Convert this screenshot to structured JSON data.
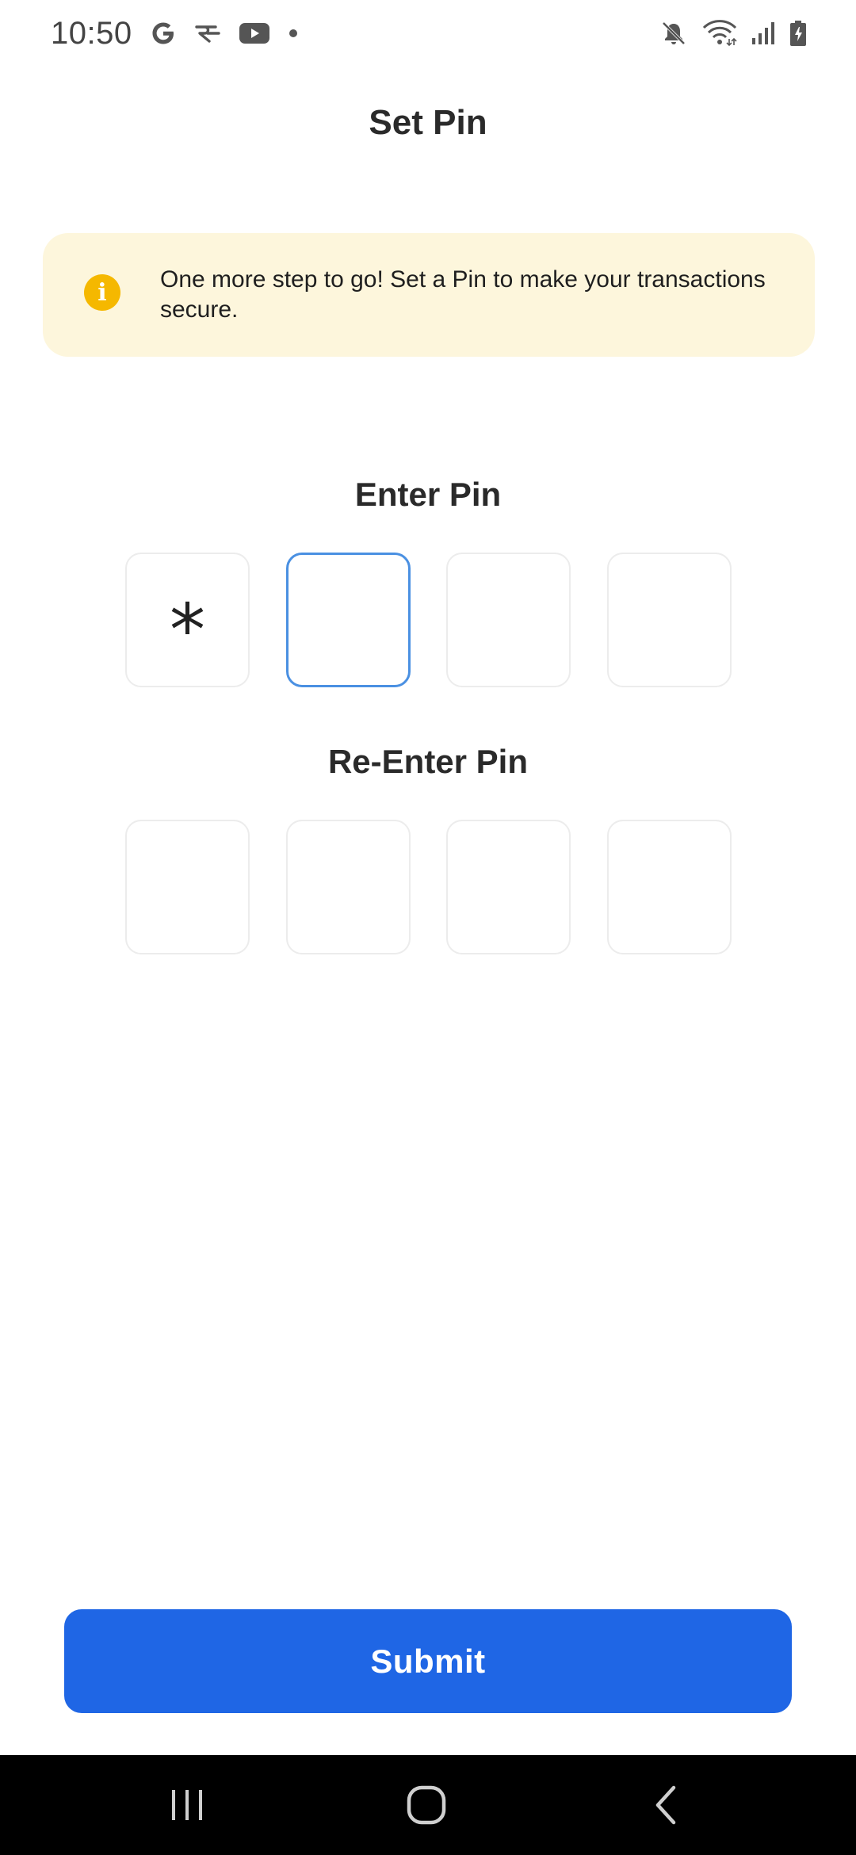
{
  "status_bar": {
    "time": "10:50",
    "left_icons": [
      "google-icon",
      "rapido-icon",
      "youtube-icon",
      "dot-icon"
    ],
    "right_icons": [
      "mute-icon",
      "wifi-icon",
      "signal-icon",
      "battery-icon"
    ]
  },
  "header": {
    "title": "Set Pin"
  },
  "info_banner": {
    "icon": "info-icon",
    "icon_glyph": "i",
    "text": "One more step to go! Set a Pin to make your transactions secure.",
    "background": "#fdf6dc",
    "icon_color": "#f5b800"
  },
  "enter_pin": {
    "label": "Enter Pin",
    "boxes": [
      "*",
      "",
      "",
      ""
    ],
    "focused_index": 1
  },
  "reenter_pin": {
    "label": "Re-Enter Pin",
    "boxes": [
      "",
      "",
      "",
      ""
    ]
  },
  "submit": {
    "label": "Submit",
    "color": "#1f66e5"
  },
  "nav_bar": {
    "buttons": [
      "recents-icon",
      "home-icon",
      "back-icon"
    ]
  }
}
